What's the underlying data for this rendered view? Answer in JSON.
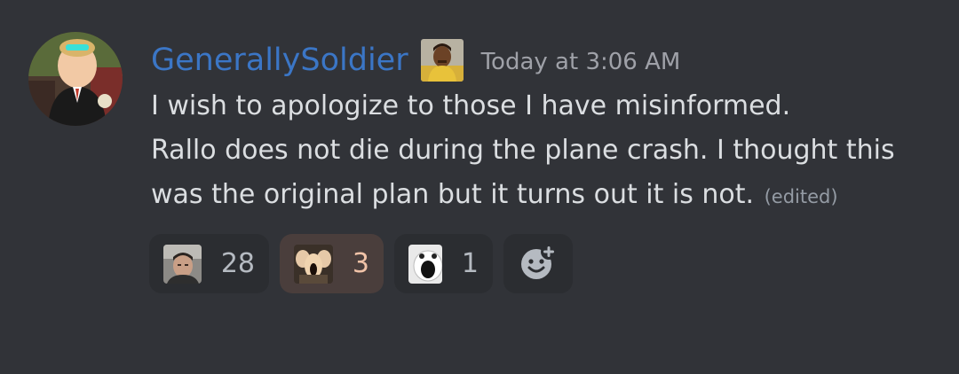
{
  "message": {
    "author": "GenerallySoldier",
    "timestamp": "Today at 3:06 AM",
    "lines": [
      "I wish to apologize to those I have misinformed.",
      "Rallo does not die during the plane crash. I thought this",
      "was the original plan but it turns out it is not."
    ],
    "edited_label": "(edited)"
  },
  "reactions": [
    {
      "emoji": "custom-face-emoji",
      "count": "28",
      "active": false
    },
    {
      "emoji": "custom-screaming-emoji",
      "count": "3",
      "active": true
    },
    {
      "emoji": "custom-shocked-dog-emoji",
      "count": "1",
      "active": false
    }
  ],
  "add_reaction": {
    "icon": "add-reaction-icon"
  },
  "colors": {
    "background": "#313338",
    "username": "#3b76c6",
    "text": "#dbdee1",
    "timestamp": "#9fa1a8",
    "reaction_bg": "#2b2d31",
    "reaction_active_bg": "#4a3e3c",
    "reaction_active_count": "#f1c3a8"
  }
}
